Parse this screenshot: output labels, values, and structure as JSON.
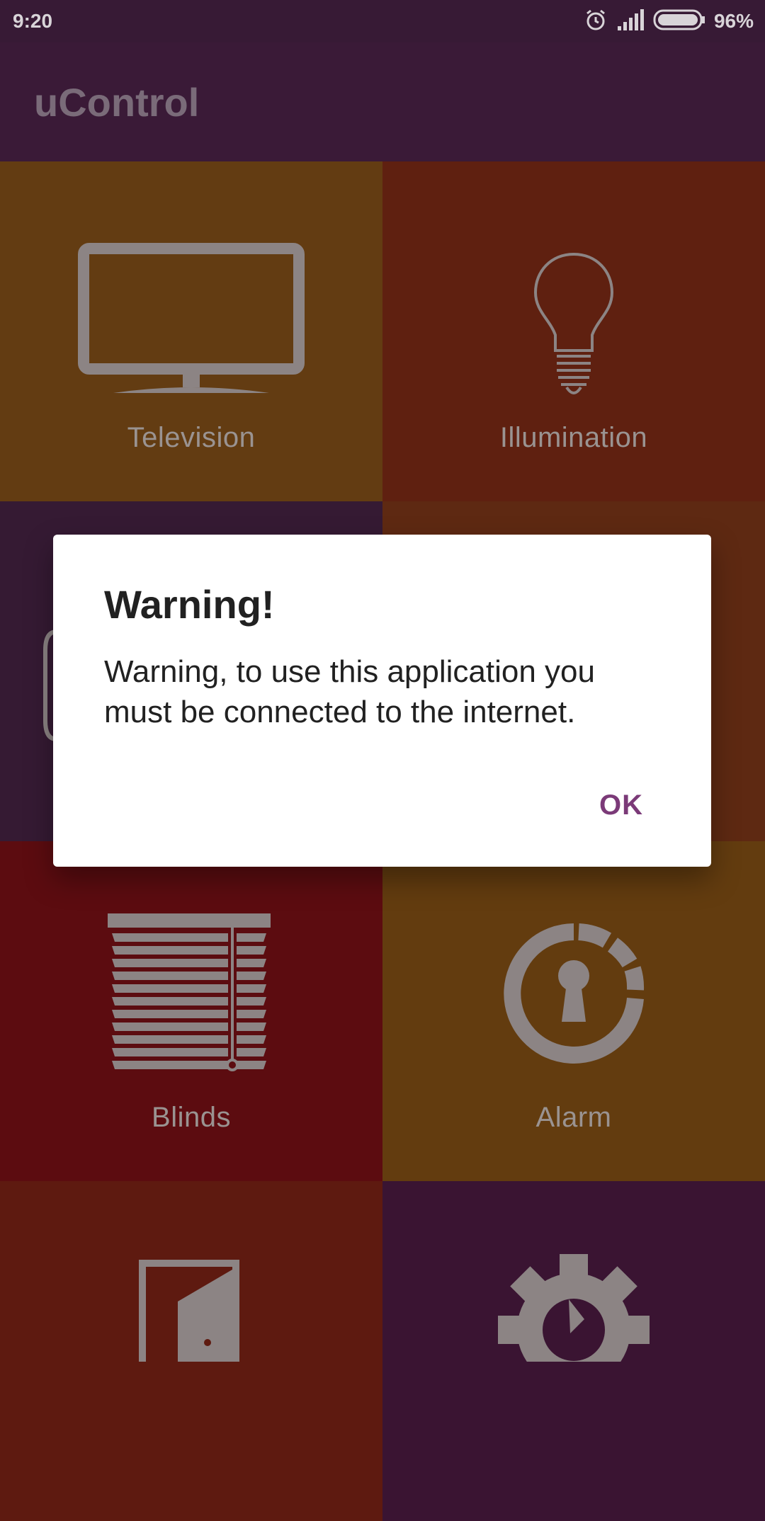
{
  "status_bar": {
    "time": "9:20",
    "battery": "96%",
    "icons": [
      "alarm-icon",
      "signal-icon",
      "battery-icon"
    ]
  },
  "app_bar": {
    "title": "uControl"
  },
  "tiles": [
    {
      "label": "Television",
      "icon": "television-icon",
      "color": "#633c12"
    },
    {
      "label": "Illumination",
      "icon": "lightbulb-icon",
      "color": "#5f2010"
    },
    {
      "label": "",
      "icon": "",
      "color": "#351a33"
    },
    {
      "label": "",
      "icon": "",
      "color": "#5e2912"
    },
    {
      "label": "Blinds",
      "icon": "blinds-icon",
      "color": "#5c0c10"
    },
    {
      "label": "Alarm",
      "icon": "alarm-lock-icon",
      "color": "#633c0f"
    },
    {
      "label": "",
      "icon": "door-icon",
      "color": "#5e1a10"
    },
    {
      "label": "",
      "icon": "settings-gear-icon",
      "color": "#3a1432"
    }
  ],
  "dialog": {
    "title": "Warning!",
    "message": "Warning, to use this application you must be connected to the internet.",
    "ok_label": "OK",
    "accent_color": "#7b3a78"
  }
}
